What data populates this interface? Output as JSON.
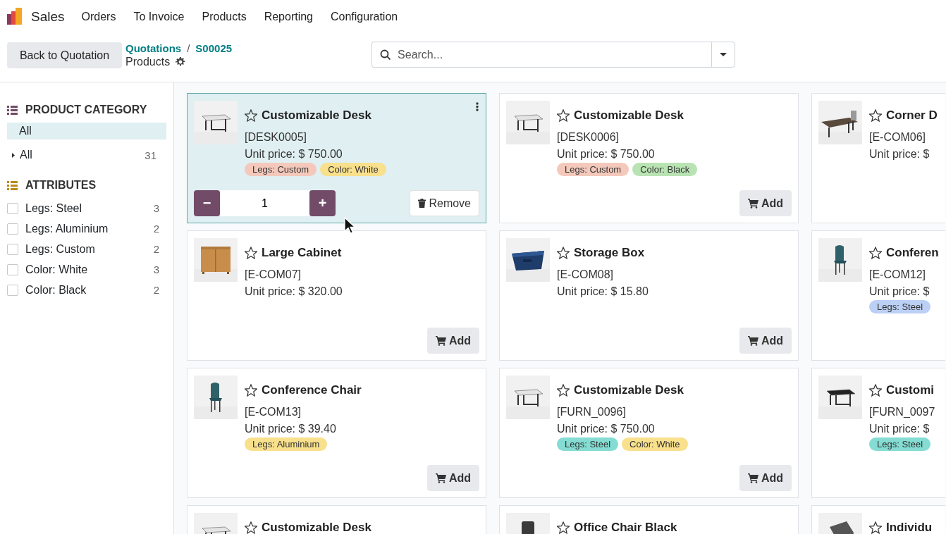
{
  "navbar": {
    "app": "Sales",
    "menu": [
      "Orders",
      "To Invoice",
      "Products",
      "Reporting",
      "Configuration"
    ]
  },
  "control_panel": {
    "back_button": "Back to Quotation",
    "breadcrumb": {
      "path": [
        "Quotations",
        "S00025"
      ],
      "separator": "/",
      "current": "Products"
    },
    "search": {
      "placeholder": "Search..."
    }
  },
  "sidebar": {
    "sections": [
      {
        "title": "PRODUCT CATEGORY",
        "kind": "category",
        "color": "#714b67",
        "items": [
          {
            "label": "All",
            "selected": true
          },
          {
            "label": "All",
            "count": "31",
            "selected": false,
            "expanded": false
          }
        ]
      },
      {
        "title": "ATTRIBUTES",
        "kind": "filter",
        "color": "#b8891b",
        "items": [
          {
            "label": "Legs: Steel",
            "count": "3",
            "checked": false
          },
          {
            "label": "Legs: Aluminium",
            "count": "2",
            "checked": false
          },
          {
            "label": "Legs: Custom",
            "count": "2",
            "checked": false
          },
          {
            "label": "Color: White",
            "count": "3",
            "checked": false
          },
          {
            "label": "Color: Black",
            "count": "2",
            "checked": false
          }
        ]
      }
    ]
  },
  "products": [
    {
      "name": "Customizable Desk",
      "favorite": false,
      "ref": "[DESK0005]",
      "price": "Unit price: $ 750.00",
      "selected": true,
      "tags": [
        {
          "label": "Legs: Custom",
          "color": "#f4c9bb"
        },
        {
          "label": "Color: White",
          "color": "#f8e08c"
        }
      ],
      "quantity": {
        "minus": "−",
        "value": "1",
        "plus": "+"
      },
      "action": {
        "kind": "remove",
        "label": "Remove"
      },
      "menu": true
    },
    {
      "name": "Customizable Desk",
      "favorite": false,
      "ref": "[DESK0006]",
      "price": "Unit price: $ 750.00",
      "selected": false,
      "tags": [
        {
          "label": "Legs: Custom",
          "color": "#f4c9bb"
        },
        {
          "label": "Color: Black",
          "color": "#b9e3b3"
        }
      ],
      "action": {
        "kind": "add",
        "label": "Add"
      }
    },
    {
      "name": "Corner D",
      "favorite": false,
      "ref": "[E-COM06]",
      "price": "Unit price: $",
      "selected": false
    },
    {
      "name": "Large Cabinet",
      "favorite": false,
      "ref": "[E-COM07]",
      "price": "Unit price: $ 320.00",
      "selected": false,
      "action": {
        "kind": "add",
        "label": "Add"
      }
    },
    {
      "name": "Storage Box",
      "favorite": false,
      "ref": "[E-COM08]",
      "price": "Unit price: $ 15.80",
      "selected": false,
      "action": {
        "kind": "add",
        "label": "Add"
      }
    },
    {
      "name": "Conferen",
      "favorite": false,
      "ref": "[E-COM12]",
      "price": "Unit price: $",
      "selected": false,
      "tags": [
        {
          "label": "Legs: Steel",
          "color": "#bcd0f5"
        }
      ]
    },
    {
      "name": "Conference Chair",
      "favorite": false,
      "ref": "[E-COM13]",
      "price": "Unit price: $ 39.40",
      "selected": false,
      "tags": [
        {
          "label": "Legs: Aluminium",
          "color": "#f8e08c"
        }
      ],
      "action": {
        "kind": "add",
        "label": "Add"
      }
    },
    {
      "name": "Customizable Desk",
      "favorite": false,
      "ref": "[FURN_0096]",
      "price": "Unit price: $ 750.00",
      "selected": false,
      "tags": [
        {
          "label": "Legs: Steel",
          "color": "#84dcd2"
        },
        {
          "label": "Color: White",
          "color": "#f8e08c"
        }
      ],
      "action": {
        "kind": "add",
        "label": "Add"
      }
    },
    {
      "name": "Customi",
      "favorite": false,
      "ref": "[FURN_0097",
      "price": "Unit price: $",
      "selected": false,
      "tags": [
        {
          "label": "Legs: Steel",
          "color": "#84dcd2"
        }
      ]
    },
    {
      "name": "Customizable Desk",
      "favorite": false,
      "selected": false
    },
    {
      "name": "Office Chair Black",
      "favorite": false,
      "selected": false
    },
    {
      "name": "Individu",
      "favorite": false,
      "selected": false
    }
  ]
}
